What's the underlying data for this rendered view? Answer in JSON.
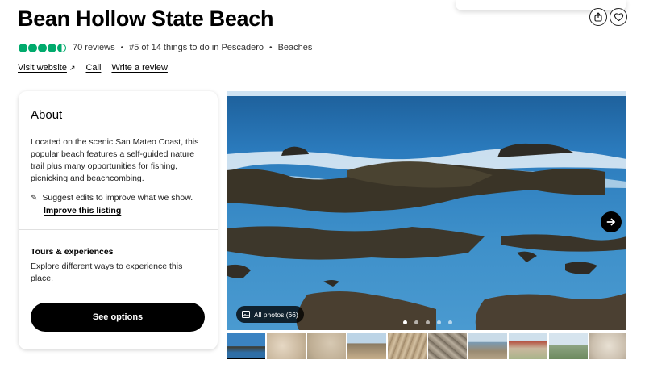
{
  "page": {
    "title": "Bean Hollow State Beach"
  },
  "header_actions": {
    "icons": [
      "share-icon",
      "heart-icon"
    ]
  },
  "rating": {
    "score": 4.5,
    "max": 5,
    "reviews": "70 reviews",
    "ranking": "#5 of 14 things to do in Pescadero",
    "category": "Beaches",
    "separator": "•",
    "color": "#00aa6c"
  },
  "links": {
    "visit_website": "Visit website",
    "call": "Call",
    "write_review": "Write a review"
  },
  "about": {
    "title": "About",
    "description": "Located on the scenic San Mateo Coast, this popular beach features a self-guided nature trail plus many opportunities for fishing, picnicking and beachcombing.",
    "suggest_text": "Suggest edits to improve what we show.",
    "improve_link": "Improve this listing"
  },
  "tours": {
    "title": "Tours & experiences",
    "description": "Explore different ways to experience this place.",
    "button": "See options"
  },
  "gallery": {
    "all_photos": "All photos (66)",
    "page_dots": 5,
    "active_dot": 1,
    "thumbnail_count": 10
  }
}
